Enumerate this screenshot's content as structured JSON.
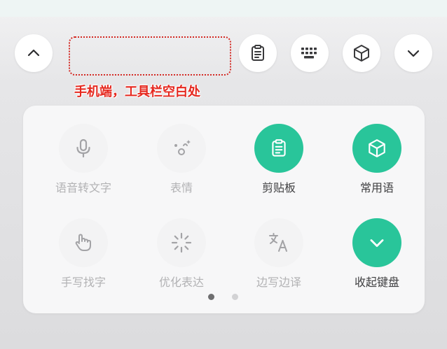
{
  "toolbar": {
    "expand_button": "chevron-up-icon",
    "clipboard_button": "clipboard-icon",
    "keyboard_button": "keyboard-icon",
    "phrases_button": "cube-icon",
    "collapse_button": "chevron-down-icon"
  },
  "annotation": {
    "text": "手机端，工具栏空白处",
    "color": "#e5281f"
  },
  "panel": {
    "tiles": [
      {
        "label": "语音转文字",
        "icon": "microphone-icon",
        "enabled": false
      },
      {
        "label": "表情",
        "icon": "emoji-face-icon",
        "enabled": false
      },
      {
        "label": "剪贴板",
        "icon": "clipboard-icon",
        "enabled": true
      },
      {
        "label": "常用语",
        "icon": "cube-icon",
        "enabled": true
      },
      {
        "label": "手写找字",
        "icon": "handwriting-hand-icon",
        "enabled": false
      },
      {
        "label": "优化表达",
        "icon": "sparkle-burst-icon",
        "enabled": false
      },
      {
        "label": "边写边译",
        "icon": "translate-icon",
        "enabled": false
      },
      {
        "label": "收起键盘",
        "icon": "chevron-down-icon",
        "enabled": true
      }
    ],
    "page_indicator": {
      "pages": 2,
      "current": 1
    }
  },
  "colors": {
    "accent_green": "#29c59a",
    "muted_text": "#b2b2b4",
    "dark_text": "#404042"
  }
}
